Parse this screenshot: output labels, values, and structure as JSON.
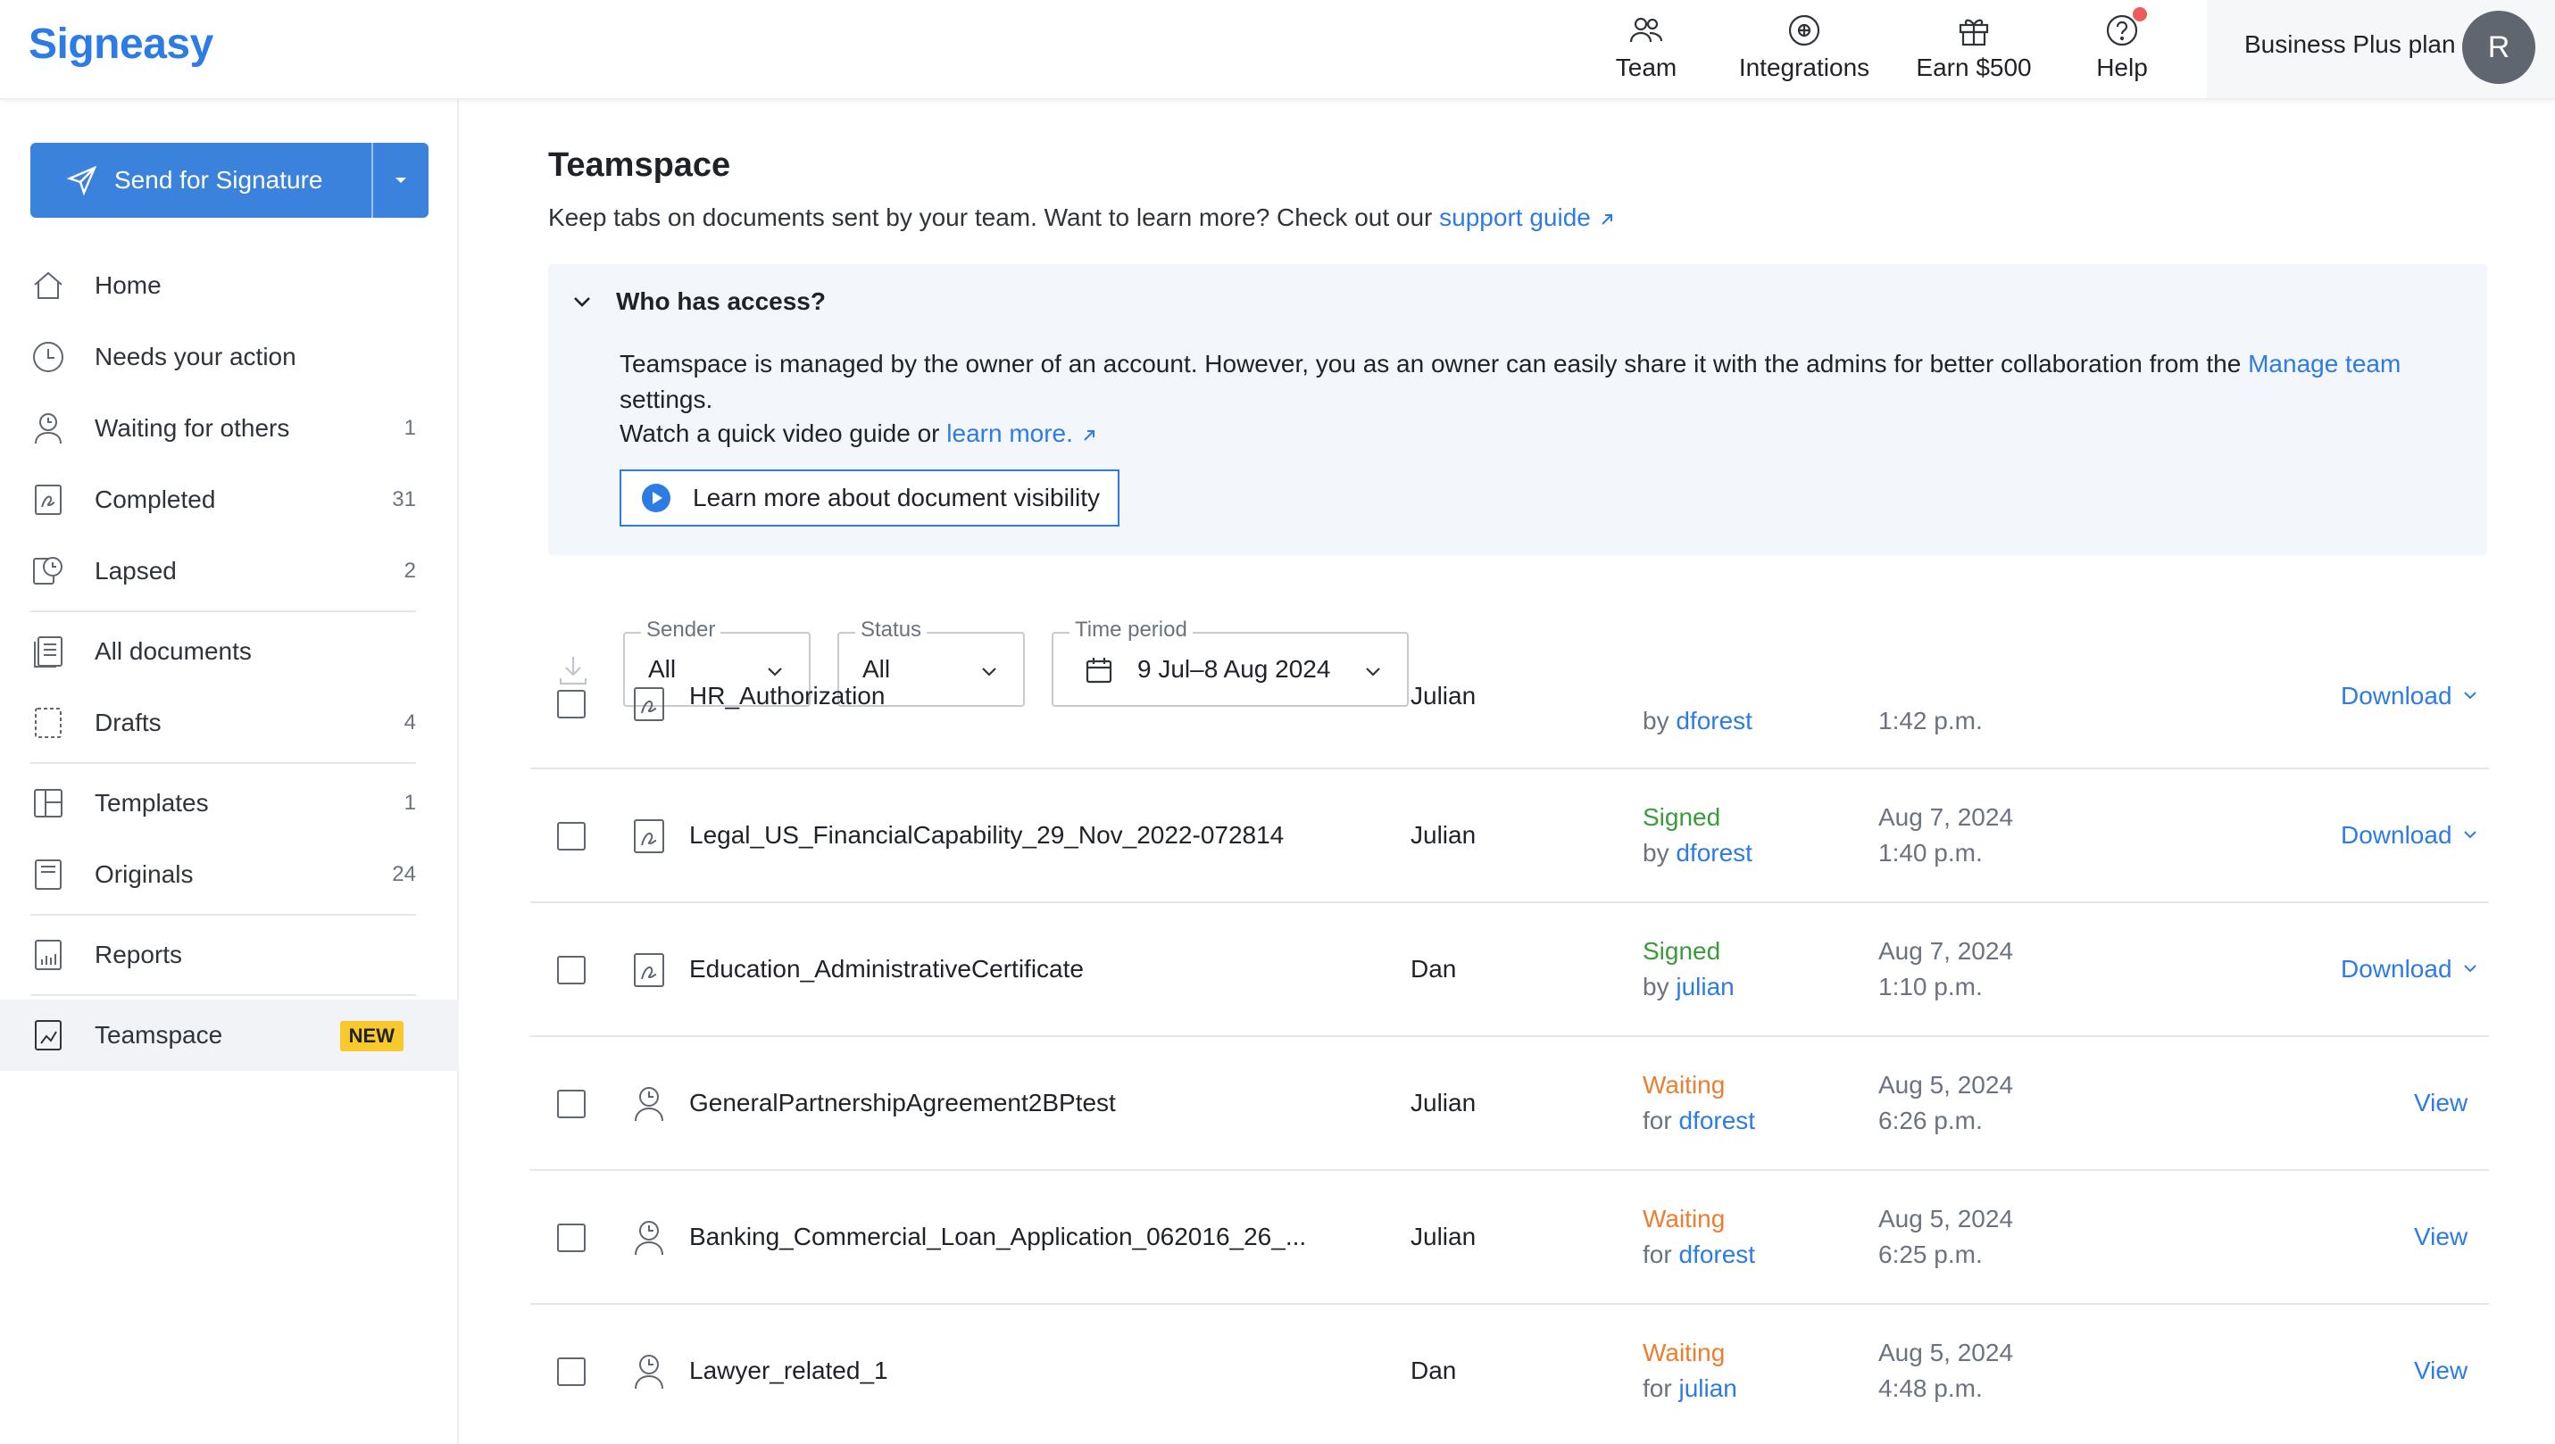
{
  "app": {
    "logo": "Signeasy",
    "plan": "Business Plus plan",
    "avatar_initial": "R",
    "accent": "#2d7be5"
  },
  "topnav": [
    {
      "label": "Team",
      "icon": "team-icon"
    },
    {
      "label": "Integrations",
      "icon": "integrations-icon"
    },
    {
      "label": "Earn $500",
      "icon": "gift-icon"
    },
    {
      "label": "Help",
      "icon": "help-icon"
    }
  ],
  "sidebar": {
    "send_label": "Send for Signature",
    "items": [
      {
        "label": "Home",
        "count": "",
        "icon": "home-icon"
      },
      {
        "label": "Needs your action",
        "count": "",
        "icon": "clock-icon"
      },
      {
        "label": "Waiting for others",
        "count": "1",
        "icon": "person-clock-icon"
      },
      {
        "label": "Completed",
        "count": "31",
        "icon": "signed-doc-icon"
      },
      {
        "label": "Lapsed",
        "count": "2",
        "icon": "lapsed-icon"
      },
      {
        "label": "All documents",
        "count": "",
        "icon": "documents-icon"
      },
      {
        "label": "Drafts",
        "count": "4",
        "icon": "draft-icon"
      },
      {
        "label": "Templates",
        "count": "1",
        "icon": "template-icon"
      },
      {
        "label": "Originals",
        "count": "24",
        "icon": "original-icon"
      },
      {
        "label": "Reports",
        "count": "",
        "icon": "reports-icon"
      },
      {
        "label": "Teamspace",
        "badge": "NEW",
        "icon": "teamspace-icon"
      }
    ]
  },
  "page": {
    "title": "Teamspace",
    "subtitle": "Keep tabs on documents sent by your team. Want to learn more? Check out our ",
    "subtitle_link": "support guide",
    "access": {
      "title": "Who has access?",
      "text1": "Teamspace is managed by the owner of an account. However, you as an owner can easily share it with the admins for better collaboration from the ",
      "text1_link": "Manage team",
      "text1_end": " settings.",
      "text2": "Watch a quick video guide or ",
      "text2_link": "learn more.",
      "video_label": "Learn more about document visibility"
    }
  },
  "filters": {
    "sender": {
      "legend": "Sender",
      "value": "All"
    },
    "status": {
      "legend": "Status",
      "value": "All"
    },
    "period": {
      "legend": "Time period",
      "value": "9 Jul–8 Aug 2024"
    }
  },
  "rows": [
    {
      "name": "HR_Authorization",
      "owner": "Julian",
      "status": "",
      "by_prefix": "by ",
      "by": "dforest",
      "date": "",
      "time": "1:42 p.m.",
      "action": "Download",
      "kind": "signed"
    },
    {
      "name": "Legal_US_FinancialCapability_29_Nov_2022-072814",
      "owner": "Julian",
      "status": "Signed",
      "by_prefix": "by ",
      "by": "dforest",
      "date": "Aug 7, 2024",
      "time": "1:40 p.m.",
      "action": "Download",
      "kind": "signed"
    },
    {
      "name": "Education_AdministrativeCertificate",
      "owner": "Dan",
      "status": "Signed",
      "by_prefix": "by ",
      "by": "julian",
      "date": "Aug 7, 2024",
      "time": "1:10 p.m.",
      "action": "Download",
      "kind": "signed"
    },
    {
      "name": "GeneralPartnershipAgreement2BPtest",
      "owner": "Julian",
      "status": "Waiting",
      "by_prefix": "for ",
      "by": "dforest",
      "date": "Aug 5, 2024",
      "time": "6:26 p.m.",
      "action": "View",
      "kind": "waiting"
    },
    {
      "name": "Banking_Commercial_Loan_Application_062016_26_...",
      "owner": "Julian",
      "status": "Waiting",
      "by_prefix": "for ",
      "by": "dforest",
      "date": "Aug 5, 2024",
      "time": "6:25 p.m.",
      "action": "View",
      "kind": "waiting"
    },
    {
      "name": "Lawyer_related_1",
      "owner": "Dan",
      "status": "Waiting",
      "by_prefix": "for ",
      "by": "julian",
      "date": "Aug 5, 2024",
      "time": "4:48 p.m.",
      "action": "View",
      "kind": "waiting"
    }
  ]
}
